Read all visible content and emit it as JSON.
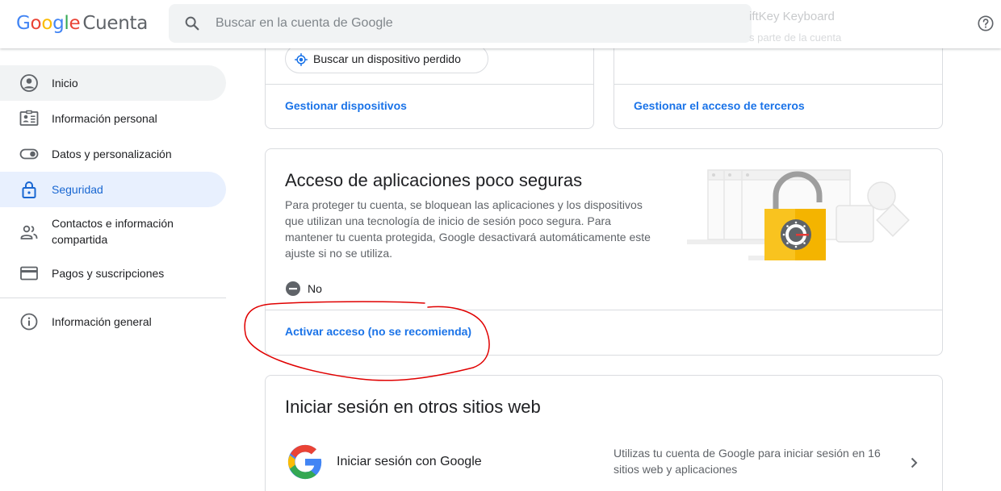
{
  "header": {
    "logo_google": [
      "G",
      "o",
      "o",
      "g",
      "l",
      "e"
    ],
    "product": "Cuenta",
    "search_placeholder": "Buscar en la cuenta de Google",
    "ghost_title": "iftKey Keyboard",
    "ghost_sub": "s parte de la cuenta"
  },
  "sidebar": {
    "items": [
      {
        "label": "Inicio",
        "icon": "person-circle-icon"
      },
      {
        "label": "Información personal",
        "icon": "id-card-icon"
      },
      {
        "label": "Datos y personalización",
        "icon": "toggle-icon"
      },
      {
        "label": "Seguridad",
        "icon": "lock-icon"
      },
      {
        "label": "Contactos e información compartida",
        "icon": "people-icon"
      },
      {
        "label": "Pagos y suscripciones",
        "icon": "credit-card-icon"
      },
      {
        "label": "Información general",
        "icon": "info-icon"
      }
    ]
  },
  "devices_card": {
    "chip_label": "Buscar un dispositivo perdido",
    "link": "Gestionar dispositivos"
  },
  "third_party_card": {
    "link": "Gestionar el acceso de terceros"
  },
  "less_secure_card": {
    "title": "Acceso de aplicaciones poco seguras",
    "description": "Para proteger tu cuenta, se bloquean las aplicaciones y los dispositivos que utilizan una tecnología de inicio de sesión poco segura. Para mantener tu cuenta protegida, Google desactivará automáticamente este ajuste si no se utiliza.",
    "status": "No",
    "link": "Activar acceso (no se recomienda)"
  },
  "other_sites_card": {
    "title": "Iniciar sesión en otros sitios web",
    "row_title": "Iniciar sesión con Google",
    "row_description": "Utilizas tu cuenta de Google para iniciar sesión en 16 sitios web y aplicaciones"
  },
  "colors": {
    "accent": "#1a73e8",
    "active_nav_bg": "#e8f0fe",
    "annotation": "#e00000",
    "lock_body": "#f4b400"
  }
}
